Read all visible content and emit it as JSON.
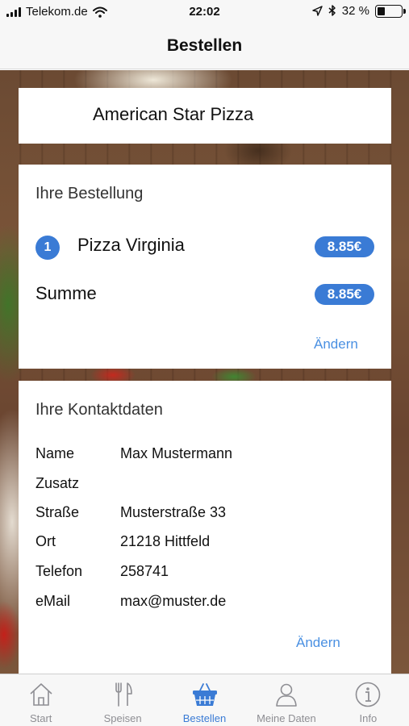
{
  "status_bar": {
    "carrier": "Telekom.de",
    "time": "22:02",
    "battery_percent": "32 %",
    "battery_level": 0.32
  },
  "nav": {
    "title": "Bestellen"
  },
  "restaurant": {
    "name": "American Star Pizza"
  },
  "order": {
    "heading": "Ihre Bestellung",
    "items": [
      {
        "quantity": "1",
        "name": "Pizza Virginia",
        "price": "8.85€"
      }
    ],
    "sum_label": "Summe",
    "sum_price": "8.85€",
    "change_label": "Ändern"
  },
  "contact": {
    "heading": "Ihre Kontaktdaten",
    "rows": [
      {
        "label": "Name",
        "value": "Max Mustermann"
      },
      {
        "label": "Zusatz",
        "value": ""
      },
      {
        "label": "Straße",
        "value": "Musterstraße 33"
      },
      {
        "label": "Ort",
        "value": "21218 Hittfeld"
      },
      {
        "label": "Telefon",
        "value": "258741"
      },
      {
        "label": "eMail",
        "value": "max@muster.de"
      }
    ],
    "change_label": "Ändern"
  },
  "tabs": [
    {
      "label": "Start",
      "icon": "home-icon"
    },
    {
      "label": "Speisen",
      "icon": "cutlery-icon"
    },
    {
      "label": "Bestellen",
      "icon": "basket-icon",
      "active": true
    },
    {
      "label": "Meine Daten",
      "icon": "person-icon"
    },
    {
      "label": "Info",
      "icon": "info-icon"
    }
  ],
  "colors": {
    "accent": "#3a7bd5",
    "link": "#4a90e2",
    "tab_inactive": "#8e8e93"
  }
}
